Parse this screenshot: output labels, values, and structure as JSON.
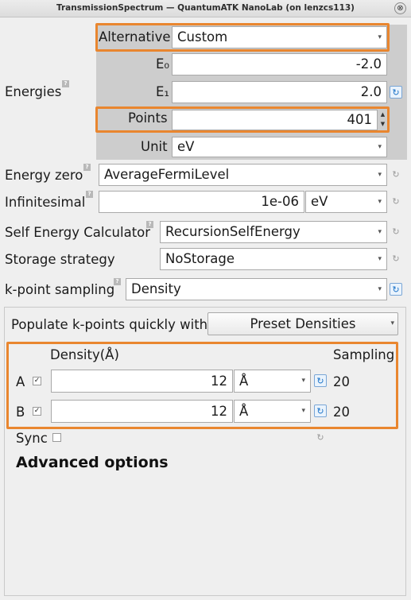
{
  "window": {
    "title": "TransmissionSpectrum — QuantumATK NanoLab (on lenzcs113)",
    "close_glyph": "⊗"
  },
  "energies": {
    "group_label": "Energies",
    "alternative_label": "Alternative",
    "alternative_value": "Custom",
    "e0_label": "E₀",
    "e0_value": "-2.0",
    "e1_label": "E₁",
    "e1_value": "2.0",
    "points_label": "Points",
    "points_value": "401",
    "unit_label": "Unit",
    "unit_value": "eV"
  },
  "energy_zero": {
    "label": "Energy zero",
    "value": "AverageFermiLevel"
  },
  "infinitesimal": {
    "label": "Infinitesimal",
    "value": "1e-06",
    "unit": "eV"
  },
  "self_energy": {
    "label": "Self Energy Calculator",
    "value": "RecursionSelfEnergy"
  },
  "storage": {
    "label": "Storage strategy",
    "value": "NoStorage"
  },
  "kpoint": {
    "label": "k-point sampling",
    "value": "Density"
  },
  "populate": {
    "label": "Populate k-points quickly with",
    "button": "Preset Densities"
  },
  "density_table": {
    "col_density": "Density(Å)",
    "col_sampling": "Sampling",
    "rows": [
      {
        "axis": "A",
        "value": "12",
        "unit": "Å",
        "sampling": "20",
        "checked": true
      },
      {
        "axis": "B",
        "value": "12",
        "unit": "Å",
        "sampling": "20",
        "checked": true
      }
    ]
  },
  "sync": {
    "label": "Sync",
    "checked": false
  },
  "advanced": {
    "label": "Advanced options"
  },
  "glyphs": {
    "check": "✓",
    "dropdown": "▾",
    "reset": "↻",
    "help": "?",
    "spin_up": "▲",
    "spin_down": "▼"
  },
  "colors": {
    "highlight": "#e9862f",
    "panel": "#cdcdcd",
    "background": "#efefef"
  }
}
